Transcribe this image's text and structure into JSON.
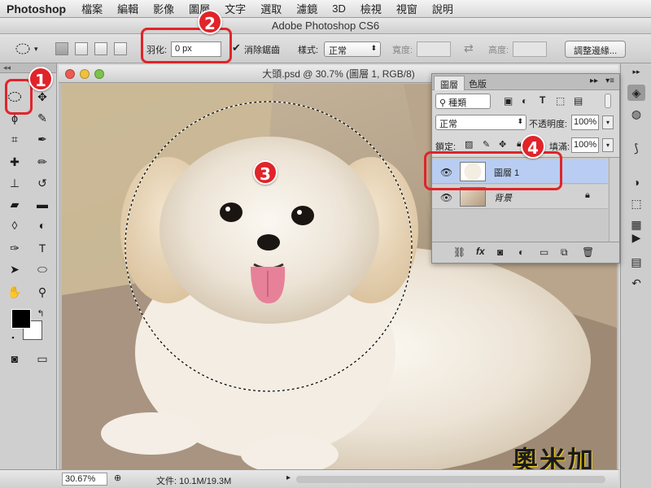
{
  "menubar": {
    "app": "Photoshop",
    "items": [
      "檔案",
      "編輯",
      "影像",
      "圖層",
      "文字",
      "選取",
      "濾鏡",
      "3D",
      "檢視",
      "視窗",
      "說明"
    ]
  },
  "title": "Adobe Photoshop CS6",
  "options": {
    "feather_label": "羽化:",
    "feather_value": "0 px",
    "antialias_label": "消除鋸齒",
    "style_label": "樣式:",
    "style_value": "正常",
    "width_label": "寬度:",
    "height_label": "高度:",
    "refine_label": "調整邊緣..."
  },
  "document": {
    "tab_title": "大頭.psd @ 30.7% (圖層 1, RGB/8)",
    "zoom": "30.67%",
    "file_info": "文件: 10.1M/19.3M"
  },
  "layers_panel": {
    "tabs": [
      "圖層",
      "色版"
    ],
    "filter_label": "種類",
    "blend_mode": "正常",
    "opacity_label": "不透明度:",
    "opacity_value": "100%",
    "lock_label": "鎖定:",
    "fill_label": "填滿:",
    "fill_value": "100%",
    "layers": [
      {
        "name": "圖層 1",
        "selected": true
      },
      {
        "name": "背景",
        "selected": false
      }
    ]
  },
  "badges": [
    "1",
    "2",
    "3",
    "4"
  ],
  "watermark": "奧米加",
  "colors": {
    "annotation_red": "#e0242a",
    "selected_layer": "#b9cdf2"
  }
}
